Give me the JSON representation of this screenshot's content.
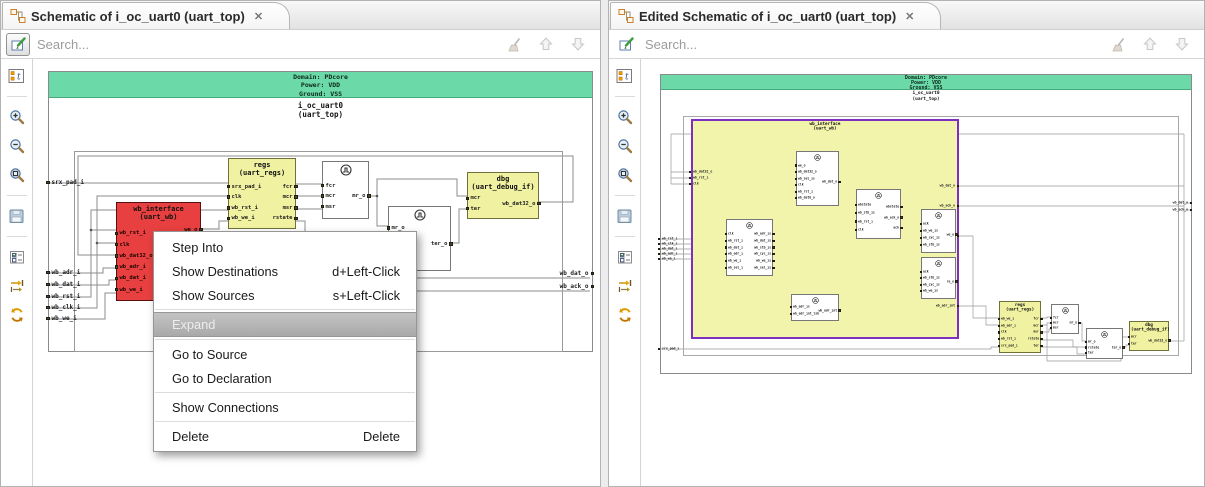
{
  "left_panel": {
    "tab": {
      "title": "Schematic of i_oc_uart0 (uart_top)",
      "close": "✕"
    },
    "search": {
      "placeholder": "Search...",
      "icons": [
        "edit-schematic",
        "clear-search",
        "previous-match",
        "next-match"
      ]
    },
    "toolbar_icons": [
      "show-schematic-contents",
      "zoom-in",
      "zoom-out",
      "zoom-fit",
      "save",
      "filter-options",
      "trace-signals",
      "refresh"
    ],
    "header": {
      "domain": "Domain: PDcore",
      "power": "Power: VDD",
      "ground": "Ground: VSS",
      "instance": "i_oc_uart0",
      "module": "(uart_top)"
    },
    "ports": {
      "input_top": "srx_pad_i",
      "inputs": [
        "wb_adr_i",
        "wb_dat_i",
        "wb_rst_i",
        "wb_clk_i",
        "wb_we_i"
      ],
      "outputs": [
        "wb_dat_o",
        "wb_ack_o"
      ]
    },
    "blocks": {
      "wb_interface": {
        "name": "wb_interface",
        "module": "(uart_wb)",
        "left": [
          "wb_rst_i",
          "clk",
          "wb_dat32_o",
          "wb_adr_i",
          "wb_dat_i",
          "wb_we_i"
        ],
        "right": [
          "we_o"
        ]
      },
      "regs": {
        "name": "regs",
        "module": "(uart_regs)",
        "left": [
          "srx_pad_i",
          "clk",
          "wb_rst_i",
          "wb_we_i"
        ],
        "right": [
          "fcr",
          "mcr",
          "msr",
          "rstate"
        ]
      },
      "ff1": {
        "left": [
          "fcr",
          "mcr",
          "msr"
        ],
        "right": [
          "mr_o"
        ]
      },
      "ff2": {
        "left": [
          "mr_o"
        ],
        "right": [
          "ter_o"
        ]
      },
      "dbg": {
        "name": "dbg",
        "module": "(uart_debug_if)",
        "left": [
          "mcr",
          "ter"
        ],
        "right": [
          "wb_dat32_o"
        ]
      }
    },
    "menu": {
      "items": [
        {
          "label": "Step Into",
          "accel": ""
        },
        {
          "label": "Show Destinations",
          "accel": "d+Left-Click"
        },
        {
          "label": "Show Sources",
          "accel": "s+Left-Click"
        },
        {
          "label": "Expand",
          "accel": "",
          "state": "highlighted-disabled"
        },
        {
          "label": "Go to Source",
          "accel": ""
        },
        {
          "label": "Go to Declaration",
          "accel": ""
        },
        {
          "label": "Show Connections",
          "accel": ""
        },
        {
          "label": "Delete",
          "accel": "Delete"
        }
      ]
    }
  },
  "right_panel": {
    "tab": {
      "title": "Edited Schematic of i_oc_uart0 (uart_top)",
      "close": "✕"
    },
    "search": {
      "placeholder": "Search..."
    },
    "header": {
      "domain": "Domain: PDcore",
      "power": "Power: VDD",
      "ground": "Ground: VSS",
      "instance": "i_oc_uart0",
      "module": "(uart_top)"
    },
    "ports": {
      "inputs": [
        "wb_rst_i",
        "wb_clk_i",
        "wb_dat_i",
        "wb_adr_i",
        "wb_we_i"
      ],
      "input_bottom": "srx_pad_i",
      "outputs": [
        "wb_dat_o",
        "wb_ack_o"
      ]
    },
    "wb_interface": {
      "name": "wb_interface",
      "module": "(uart_wb)",
      "edge_left": [
        "wb_dat32_o",
        "wb_rst_i",
        "clk"
      ],
      "edge_right": [
        "wb_dat_o",
        "wb_ack_o",
        "we_o",
        "wb_adr_int"
      ],
      "sub_blocks": [
        {
          "left": [
            "we_o",
            "wb_dat32_o",
            "wb_sel_is",
            "clk",
            "wb_rst_i",
            "wb_dat8_o"
          ],
          "right": [
            "wb_dat_o"
          ]
        },
        {
          "left": [
            "wbstate",
            "wb_stb_is",
            "wb_rst_i",
            "clk"
          ],
          "right": [
            "wbstate",
            "wb_ack_o",
            "ack"
          ]
        },
        {
          "left": [
            "ack",
            "wb_we_is",
            "wb_cyc_is",
            "wb_stb_is"
          ],
          "right": [
            "we_o"
          ]
        },
        {
          "left": [
            "ack",
            "wb_stb_is",
            "wb_cyc_is",
            "wb_we_is"
          ],
          "right": [
            "re_o"
          ]
        },
        {
          "left": [
            "clk",
            "wb_rst_i",
            "wb_dat_i",
            "wb_adr_i",
            "wb_we_i",
            "wb_sel_i"
          ],
          "right": [
            "wb_adr_is",
            "wb_dat_is",
            "wb_stb_is",
            "wb_cyc_is",
            "wb_we_is",
            "wb_sel_is"
          ]
        },
        {
          "left": [
            "wb_adr_is",
            "wb_adr_int_lsb"
          ],
          "right": [
            "wb_adr_int"
          ]
        }
      ]
    },
    "blocks": {
      "regs": {
        "name": "regs",
        "module": "(uart_regs)",
        "left": [
          "wb_we_i",
          "wb_adr_i",
          "clk",
          "wb_rst_i",
          "srx_pad_i"
        ],
        "right": [
          "fcr",
          "mcr",
          "msr",
          "rstate",
          "ter"
        ]
      },
      "ff3": {
        "left": [
          "fcr",
          "mcr",
          "msr"
        ],
        "right": [
          "mr_o"
        ]
      },
      "ff4": {
        "left": [
          "mr_o",
          "rstate",
          "ter"
        ],
        "right": [
          "ter_o"
        ]
      },
      "dbg": {
        "name": "dbg",
        "module": "(uart_debug_if)",
        "left": [
          "mcr",
          "ter"
        ],
        "right": [
          "wb_dat32_o"
        ]
      }
    }
  }
}
